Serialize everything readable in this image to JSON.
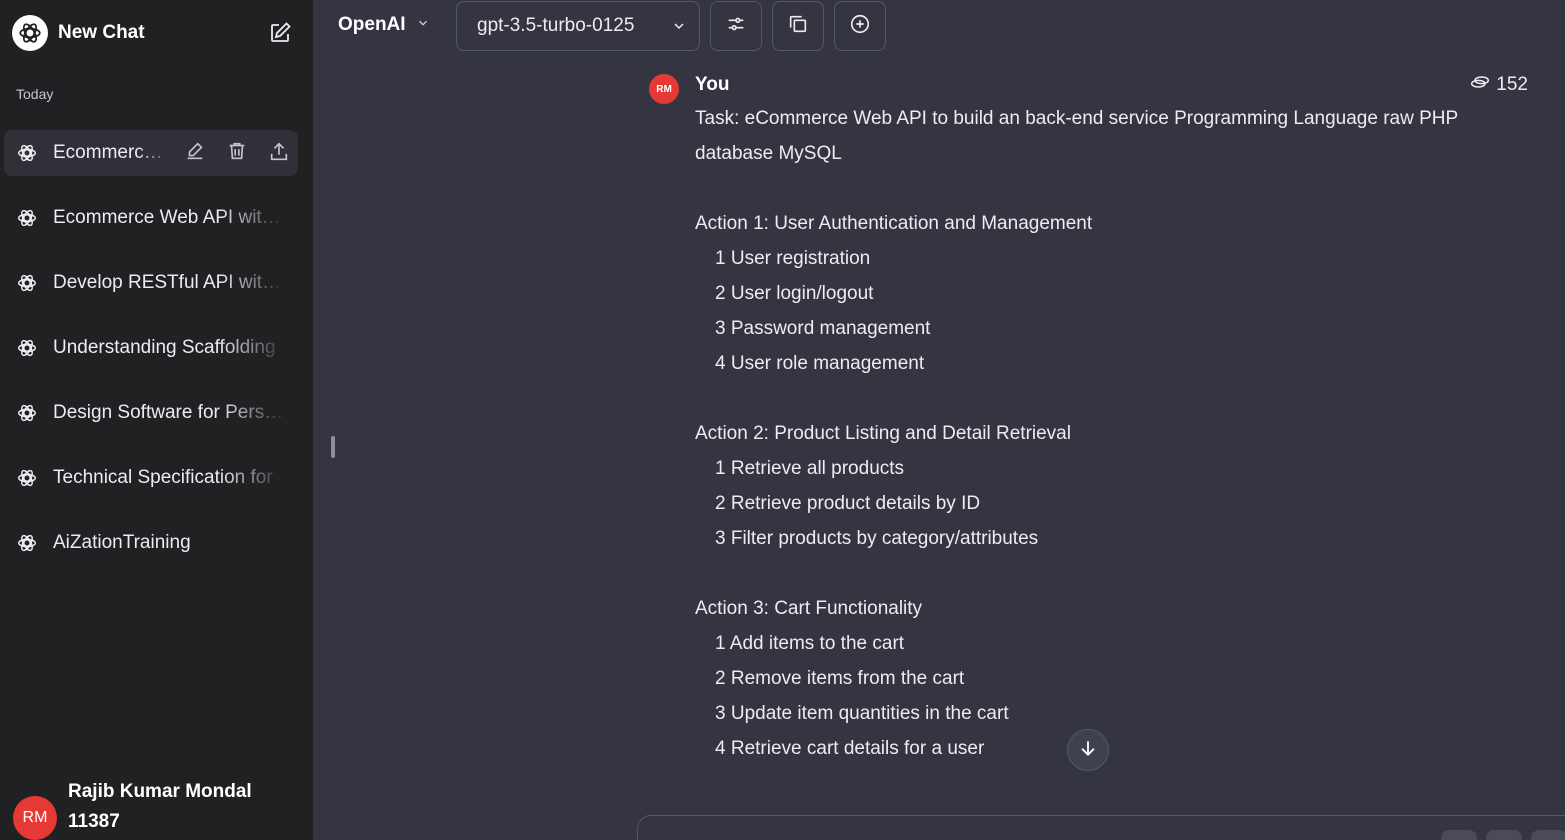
{
  "sidebar": {
    "new_chat_label": "New Chat",
    "section_label": "Today",
    "conversations": [
      {
        "label": "Ecommerce Web API with PHP"
      },
      {
        "label": "Ecommerce Web API with PHP"
      },
      {
        "label": "Develop RESTful API with PHP"
      },
      {
        "label": "Understanding Scaffolding"
      },
      {
        "label": "Design Software for Personal"
      },
      {
        "label": "Technical Specification for"
      },
      {
        "label": "AiZationTraining"
      }
    ],
    "user": {
      "initials": "RM",
      "name": "Rajib Kumar Mondal",
      "credits": "11387"
    }
  },
  "header": {
    "provider": "OpenAI",
    "model": "gpt-3.5-turbo-0125"
  },
  "message": {
    "avatar_initials": "RM",
    "author": "You",
    "token_count": "152",
    "lines": [
      {
        "text": "Task: eCommerce Web API to build an back-end service Programming Language raw PHP",
        "indent": false
      },
      {
        "text": "database MySQL",
        "indent": false
      },
      {
        "text": "",
        "indent": false
      },
      {
        "text": "Action 1: User Authentication and Management",
        "indent": false
      },
      {
        "text": "1 User registration",
        "indent": true
      },
      {
        "text": "2 User login/logout",
        "indent": true
      },
      {
        "text": "3 Password management",
        "indent": true
      },
      {
        "text": "4 User role management",
        "indent": true
      },
      {
        "text": "",
        "indent": false
      },
      {
        "text": "Action 2: Product Listing and Detail Retrieval",
        "indent": false
      },
      {
        "text": "1 Retrieve all products",
        "indent": true
      },
      {
        "text": "2 Retrieve product details by ID",
        "indent": true
      },
      {
        "text": "3 Filter products by category/attributes",
        "indent": true
      },
      {
        "text": "",
        "indent": false
      },
      {
        "text": "Action 3: Cart Functionality",
        "indent": false
      },
      {
        "text": "1 Add items to the cart",
        "indent": true
      },
      {
        "text": "2 Remove items from the cart",
        "indent": true
      },
      {
        "text": "3 Update item quantities in the cart",
        "indent": true
      },
      {
        "text": "4 Retrieve cart details for a user",
        "indent": true
      }
    ]
  },
  "colors": {
    "sidebar_bg": "#202123",
    "main_bg": "#343541",
    "avatar": "#e53935"
  }
}
